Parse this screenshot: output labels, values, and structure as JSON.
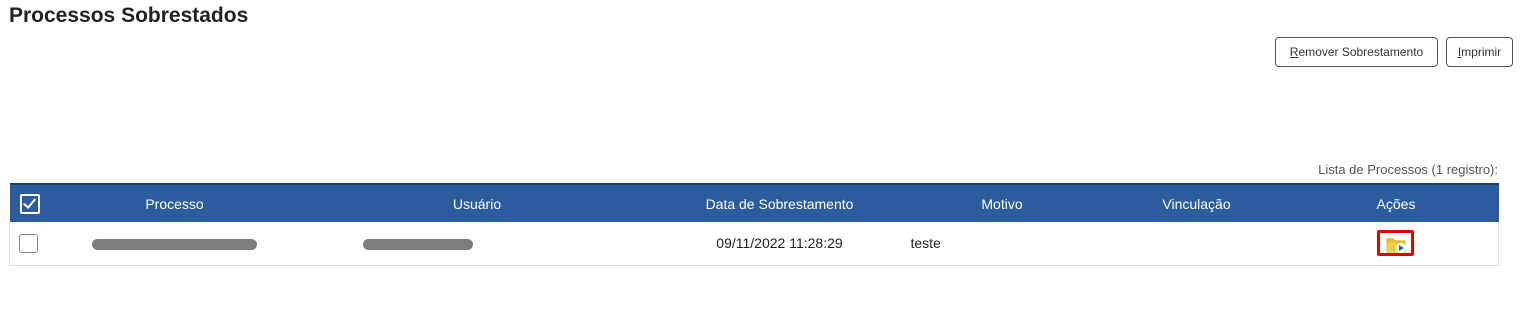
{
  "page": {
    "title": "Processos Sobrestados"
  },
  "toolbar": {
    "remove_label": "Remover Sobrestamento",
    "print_label": "Imprimir"
  },
  "table": {
    "caption": "Lista de Processos (1 registro):",
    "columns": [
      "Processo",
      "Usuário",
      "Data de Sobrestamento",
      "Motivo",
      "Vinculação",
      "Ações"
    ],
    "rows": [
      {
        "processo": "",
        "usuario": "",
        "data": "09/11/2022 11:28:29",
        "motivo": "teste",
        "vinculacao": ""
      }
    ]
  },
  "icons": {
    "header_select": "checkbox-checked-icon",
    "action": "folder-arrow-icon"
  },
  "colors": {
    "header_bg": "#2a5c9e",
    "highlight": "#e10000",
    "folder": "#f2c230"
  }
}
